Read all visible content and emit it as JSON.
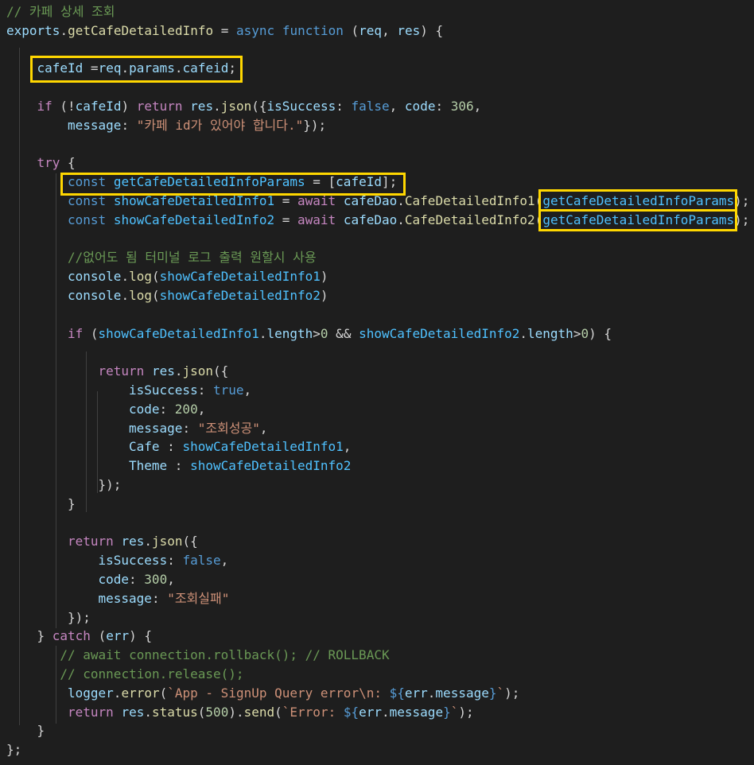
{
  "editor": {
    "theme_colors": {
      "background": "#1e1e1e",
      "highlight_box": "#ffd700",
      "comment": "#6a9955",
      "keyword": "#569cd6",
      "control": "#c586c0",
      "function": "#dcdcaa",
      "variable": "#9cdcfe",
      "constant": "#4fc1ff",
      "string": "#ce9178",
      "number": "#b5cea8"
    },
    "lines": [
      {
        "indent": 0,
        "tokens": [
          [
            "c",
            "// 카페 상세 조회"
          ]
        ]
      },
      {
        "indent": 0,
        "tokens": [
          [
            "v",
            "exports"
          ],
          [
            "p",
            "."
          ],
          [
            "f",
            "getCafeDetailedInfo"
          ],
          [
            "p",
            " = "
          ],
          [
            "k",
            "async"
          ],
          [
            "p",
            " "
          ],
          [
            "k",
            "function"
          ],
          [
            "p",
            " ("
          ],
          [
            "v",
            "req"
          ],
          [
            "p",
            ", "
          ],
          [
            "v",
            "res"
          ],
          [
            "p",
            ") {"
          ]
        ]
      },
      {
        "indent": 0,
        "tokens": []
      },
      {
        "indent": 1,
        "tokens": [
          [
            "v",
            "cafeId"
          ],
          [
            "p",
            " ="
          ],
          [
            "v",
            "req"
          ],
          [
            "p",
            "."
          ],
          [
            "v",
            "params"
          ],
          [
            "p",
            "."
          ],
          [
            "v",
            "cafeid"
          ],
          [
            "p",
            ";"
          ]
        ]
      },
      {
        "indent": 0,
        "tokens": []
      },
      {
        "indent": 1,
        "tokens": [
          [
            "ctrl",
            "if"
          ],
          [
            "p",
            " (!"
          ],
          [
            "v",
            "cafeId"
          ],
          [
            "p",
            ") "
          ],
          [
            "ctrl",
            "return"
          ],
          [
            "p",
            " "
          ],
          [
            "v",
            "res"
          ],
          [
            "p",
            "."
          ],
          [
            "f",
            "json"
          ],
          [
            "p",
            "({"
          ],
          [
            "v",
            "isSuccess"
          ],
          [
            "p",
            ": "
          ],
          [
            "k",
            "false"
          ],
          [
            "p",
            ", "
          ],
          [
            "v",
            "code"
          ],
          [
            "p",
            ": "
          ],
          [
            "n",
            "306"
          ],
          [
            "p",
            ","
          ]
        ]
      },
      {
        "indent": 2,
        "tokens": [
          [
            "v",
            "message"
          ],
          [
            "p",
            ": "
          ],
          [
            "s",
            "\"카페 id가 있어야 합니다.\""
          ],
          [
            "p",
            "});"
          ]
        ]
      },
      {
        "indent": 0,
        "tokens": []
      },
      {
        "indent": 1,
        "tokens": [
          [
            "ctrl",
            "try"
          ],
          [
            "p",
            " {"
          ]
        ]
      },
      {
        "indent": 2,
        "tokens": [
          [
            "k",
            "const"
          ],
          [
            "p",
            " "
          ],
          [
            "cst",
            "getCafeDetailedInfoParams"
          ],
          [
            "p",
            " = ["
          ],
          [
            "v",
            "cafeId"
          ],
          [
            "p",
            "];"
          ]
        ]
      },
      {
        "indent": 2,
        "tokens": [
          [
            "k",
            "const"
          ],
          [
            "p",
            " "
          ],
          [
            "cst",
            "showCafeDetailedInfo1"
          ],
          [
            "p",
            " = "
          ],
          [
            "ctrl",
            "await"
          ],
          [
            "p",
            " "
          ],
          [
            "v",
            "cafeDao"
          ],
          [
            "p",
            "."
          ],
          [
            "f",
            "CafeDetailedInfo1"
          ],
          [
            "p",
            "("
          ],
          [
            "cst",
            "getCafeDetailedInfoParams"
          ],
          [
            "p",
            ");"
          ]
        ]
      },
      {
        "indent": 2,
        "tokens": [
          [
            "k",
            "const"
          ],
          [
            "p",
            " "
          ],
          [
            "cst",
            "showCafeDetailedInfo2"
          ],
          [
            "p",
            " = "
          ],
          [
            "ctrl",
            "await"
          ],
          [
            "p",
            " "
          ],
          [
            "v",
            "cafeDao"
          ],
          [
            "p",
            "."
          ],
          [
            "f",
            "CafeDetailedInfo2"
          ],
          [
            "p",
            "("
          ],
          [
            "cst",
            "getCafeDetailedInfoParams"
          ],
          [
            "p",
            ");"
          ]
        ]
      },
      {
        "indent": 0,
        "tokens": []
      },
      {
        "indent": 2,
        "tokens": [
          [
            "c",
            "//없어도 됨 터미널 로그 출력 원할시 사용"
          ]
        ]
      },
      {
        "indent": 2,
        "tokens": [
          [
            "v",
            "console"
          ],
          [
            "p",
            "."
          ],
          [
            "f",
            "log"
          ],
          [
            "p",
            "("
          ],
          [
            "cst",
            "showCafeDetailedInfo1"
          ],
          [
            "p",
            ")"
          ]
        ]
      },
      {
        "indent": 2,
        "tokens": [
          [
            "v",
            "console"
          ],
          [
            "p",
            "."
          ],
          [
            "f",
            "log"
          ],
          [
            "p",
            "("
          ],
          [
            "cst",
            "showCafeDetailedInfo2"
          ],
          [
            "p",
            ")"
          ]
        ]
      },
      {
        "indent": 0,
        "tokens": []
      },
      {
        "indent": 2,
        "tokens": [
          [
            "ctrl",
            "if"
          ],
          [
            "p",
            " ("
          ],
          [
            "cst",
            "showCafeDetailedInfo1"
          ],
          [
            "p",
            "."
          ],
          [
            "v",
            "length"
          ],
          [
            "p",
            ">"
          ],
          [
            "n",
            "0"
          ],
          [
            "p",
            " && "
          ],
          [
            "cst",
            "showCafeDetailedInfo2"
          ],
          [
            "p",
            "."
          ],
          [
            "v",
            "length"
          ],
          [
            "p",
            ">"
          ],
          [
            "n",
            "0"
          ],
          [
            "p",
            ") {"
          ]
        ]
      },
      {
        "indent": 0,
        "tokens": []
      },
      {
        "indent": 3,
        "tokens": [
          [
            "ctrl",
            "return"
          ],
          [
            "p",
            " "
          ],
          [
            "v",
            "res"
          ],
          [
            "p",
            "."
          ],
          [
            "f",
            "json"
          ],
          [
            "p",
            "({"
          ]
        ]
      },
      {
        "indent": 4,
        "tokens": [
          [
            "v",
            "isSuccess"
          ],
          [
            "p",
            ": "
          ],
          [
            "k",
            "true"
          ],
          [
            "p",
            ","
          ]
        ]
      },
      {
        "indent": 4,
        "tokens": [
          [
            "v",
            "code"
          ],
          [
            "p",
            ": "
          ],
          [
            "n",
            "200"
          ],
          [
            "p",
            ","
          ]
        ]
      },
      {
        "indent": 4,
        "tokens": [
          [
            "v",
            "message"
          ],
          [
            "p",
            ": "
          ],
          [
            "s",
            "\"조회성공\""
          ],
          [
            "p",
            ","
          ]
        ]
      },
      {
        "indent": 4,
        "tokens": [
          [
            "v",
            "Cafe"
          ],
          [
            "p",
            " : "
          ],
          [
            "cst",
            "showCafeDetailedInfo1"
          ],
          [
            "p",
            ","
          ]
        ]
      },
      {
        "indent": 4,
        "tokens": [
          [
            "v",
            "Theme"
          ],
          [
            "p",
            " : "
          ],
          [
            "cst",
            "showCafeDetailedInfo2"
          ]
        ]
      },
      {
        "indent": 3,
        "tokens": [
          [
            "p",
            "});"
          ]
        ]
      },
      {
        "indent": 2,
        "tokens": [
          [
            "p",
            "}"
          ]
        ]
      },
      {
        "indent": 0,
        "tokens": []
      },
      {
        "indent": 2,
        "tokens": [
          [
            "ctrl",
            "return"
          ],
          [
            "p",
            " "
          ],
          [
            "v",
            "res"
          ],
          [
            "p",
            "."
          ],
          [
            "f",
            "json"
          ],
          [
            "p",
            "({"
          ]
        ]
      },
      {
        "indent": 3,
        "tokens": [
          [
            "v",
            "isSuccess"
          ],
          [
            "p",
            ": "
          ],
          [
            "k",
            "false"
          ],
          [
            "p",
            ","
          ]
        ]
      },
      {
        "indent": 3,
        "tokens": [
          [
            "v",
            "code"
          ],
          [
            "p",
            ": "
          ],
          [
            "n",
            "300"
          ],
          [
            "p",
            ","
          ]
        ]
      },
      {
        "indent": 3,
        "tokens": [
          [
            "v",
            "message"
          ],
          [
            "p",
            ": "
          ],
          [
            "s",
            "\"조회실패\""
          ]
        ]
      },
      {
        "indent": 2,
        "tokens": [
          [
            "p",
            "});"
          ]
        ]
      },
      {
        "indent": 1,
        "tokens": [
          [
            "p",
            "} "
          ],
          [
            "ctrl",
            "catch"
          ],
          [
            "p",
            " ("
          ],
          [
            "v",
            "err"
          ],
          [
            "p",
            ") {"
          ]
        ]
      },
      {
        "indent": 1.75,
        "tokens": [
          [
            "c",
            "// await connection.rollback(); // ROLLBACK"
          ]
        ]
      },
      {
        "indent": 1.75,
        "tokens": [
          [
            "c",
            "// connection.release();"
          ]
        ]
      },
      {
        "indent": 2,
        "tokens": [
          [
            "v",
            "logger"
          ],
          [
            "p",
            "."
          ],
          [
            "f",
            "error"
          ],
          [
            "p",
            "("
          ],
          [
            "s",
            "`App - SignUp Query error\\n: "
          ],
          [
            "k",
            "${"
          ],
          [
            "v",
            "err"
          ],
          [
            "p",
            "."
          ],
          [
            "v",
            "message"
          ],
          [
            "k",
            "}"
          ],
          [
            "s",
            "`"
          ],
          [
            "p",
            ");"
          ]
        ]
      },
      {
        "indent": 2,
        "tokens": [
          [
            "ctrl",
            "return"
          ],
          [
            "p",
            " "
          ],
          [
            "v",
            "res"
          ],
          [
            "p",
            "."
          ],
          [
            "f",
            "status"
          ],
          [
            "p",
            "("
          ],
          [
            "n",
            "500"
          ],
          [
            "p",
            ")."
          ],
          [
            "f",
            "send"
          ],
          [
            "p",
            "("
          ],
          [
            "s",
            "`Error: "
          ],
          [
            "k",
            "${"
          ],
          [
            "v",
            "err"
          ],
          [
            "p",
            "."
          ],
          [
            "v",
            "message"
          ],
          [
            "k",
            "}"
          ],
          [
            "s",
            "`"
          ],
          [
            "p",
            ");"
          ]
        ]
      },
      {
        "indent": 1,
        "tokens": [
          [
            "p",
            "}"
          ]
        ]
      },
      {
        "indent": 0,
        "tokens": [
          [
            "p",
            "};"
          ]
        ]
      }
    ]
  }
}
